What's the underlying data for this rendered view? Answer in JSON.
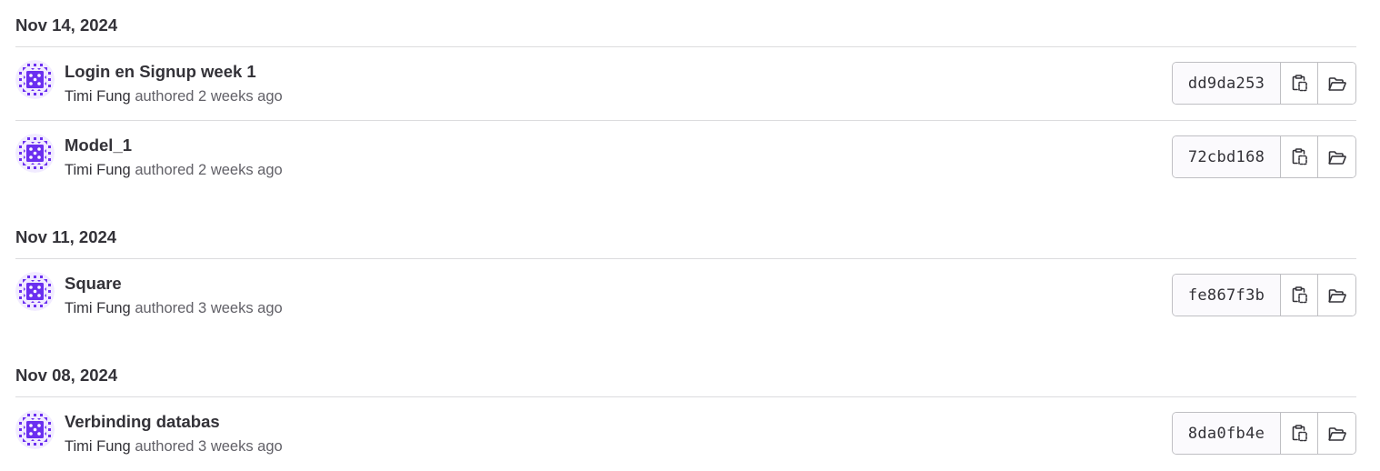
{
  "colors": {
    "avatar_purple": "#6b2ff0",
    "avatar_bg": "#f1ebff",
    "divider": "#dcdcde",
    "button_border": "#bfbfc3"
  },
  "groups": [
    {
      "date": "Nov 14, 2024",
      "commits": [
        {
          "title": "Login en Signup week 1",
          "author": "Timi Fung",
          "authored_text": " authored 2 weeks ago",
          "sha": "dd9da253",
          "avatar_icon": "identicon",
          "copy_icon": "copy-to-clipboard-icon",
          "browse_icon": "folder-open-icon"
        },
        {
          "title": "Model_1",
          "author": "Timi Fung",
          "authored_text": " authored 2 weeks ago",
          "sha": "72cbd168",
          "avatar_icon": "identicon",
          "copy_icon": "copy-to-clipboard-icon",
          "browse_icon": "folder-open-icon"
        }
      ]
    },
    {
      "date": "Nov 11, 2024",
      "commits": [
        {
          "title": "Square",
          "author": "Timi Fung",
          "authored_text": " authored 3 weeks ago",
          "sha": "fe867f3b",
          "avatar_icon": "identicon",
          "copy_icon": "copy-to-clipboard-icon",
          "browse_icon": "folder-open-icon"
        }
      ]
    },
    {
      "date": "Nov 08, 2024",
      "commits": [
        {
          "title": "Verbinding databas",
          "author": "Timi Fung",
          "authored_text": " authored 3 weeks ago",
          "sha": "8da0fb4e",
          "avatar_icon": "identicon",
          "copy_icon": "copy-to-clipboard-icon",
          "browse_icon": "folder-open-icon"
        }
      ]
    }
  ]
}
